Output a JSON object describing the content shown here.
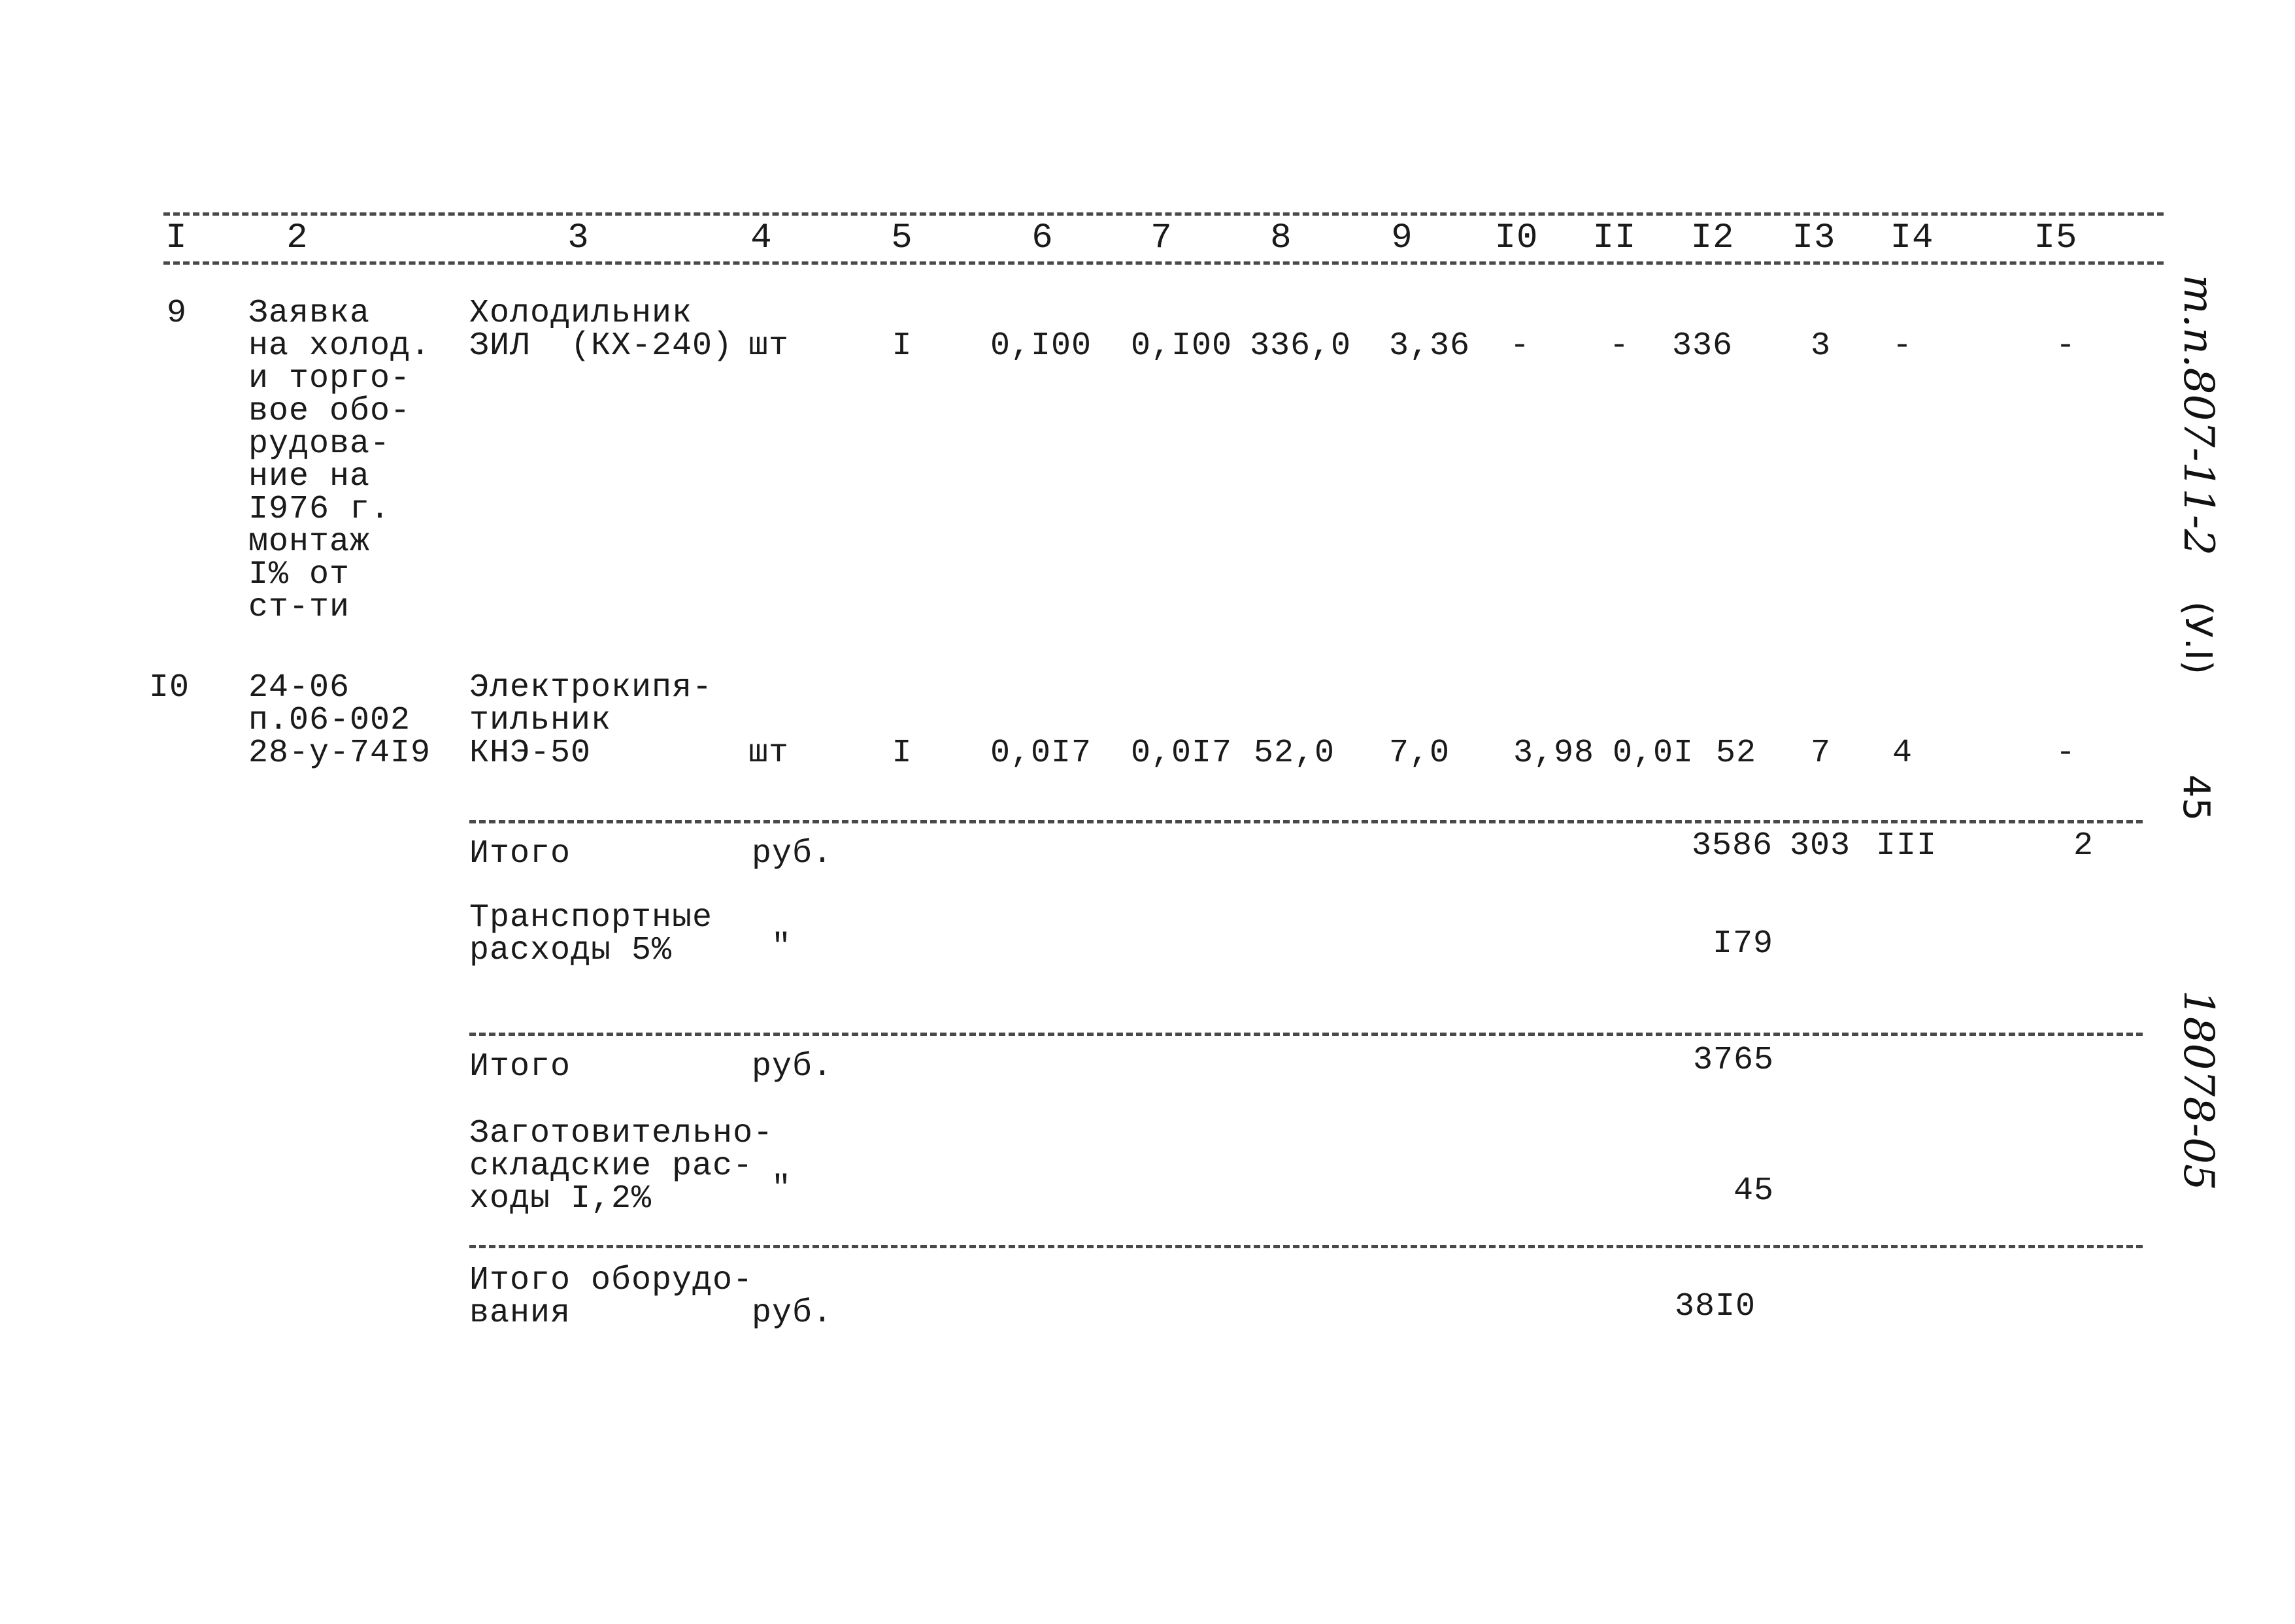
{
  "header": {
    "columns": [
      "I",
      "2",
      "3",
      "4",
      "5",
      "6",
      "7",
      "8",
      "9",
      "I0",
      "II",
      "I2",
      "I3",
      "I4",
      "I5"
    ]
  },
  "rows": [
    {
      "num": "9",
      "basis": [
        "Заявка",
        "на холод.",
        "и торго-",
        "вое обо-",
        "рудова-",
        "ние на",
        "I976 г.",
        "монтаж",
        "I% от",
        "ст-ти"
      ],
      "name": [
        "Холодильник",
        "ЗИЛ  (КХ-240)"
      ],
      "unit": "шт",
      "qty": "I",
      "c6": "0,I00",
      "c7": "0,I00",
      "c8": "336,0",
      "c9": "3,36",
      "c10": "-",
      "c11": "-",
      "c12": "336",
      "c13": "3",
      "c14": "-",
      "c15": "-"
    },
    {
      "num": "I0",
      "basis": [
        "24-06",
        "п.06-002",
        "28-у-74I9"
      ],
      "name": [
        "Электрокипя-",
        "тильник",
        "КНЭ-50"
      ],
      "unit": "шт",
      "qty": "I",
      "c6": "0,0I7",
      "c7": "0,0I7",
      "c8": "52,0",
      "c9": "7,0",
      "c10": "3,98",
      "c11": "0,0I",
      "c12": "52",
      "c13": "7",
      "c14": "4",
      "c15": "-"
    }
  ],
  "summary": [
    {
      "label": [
        "Итого"
      ],
      "unit": "руб.",
      "c12": "3586",
      "c13": "303",
      "c14": "III",
      "c15": "2"
    },
    {
      "label": [
        "Транспортные",
        "расходы 5%"
      ],
      "unit": "\"",
      "c12": "I79"
    },
    {
      "label": [
        "Итого"
      ],
      "unit": "руб.",
      "c12": "3765"
    },
    {
      "label": [
        "Заготовительно-",
        "складские рас-",
        "ходы I,2%"
      ],
      "unit": "\"",
      "c12": "45"
    },
    {
      "label": [
        "Итого оборудо-",
        "вания"
      ],
      "unit": "руб.",
      "c12": "38I0"
    }
  ],
  "side_notes": {
    "project": "т.п.807-11-2",
    "volume": "(У.I)",
    "page": "45",
    "inventory": "18078-05"
  }
}
